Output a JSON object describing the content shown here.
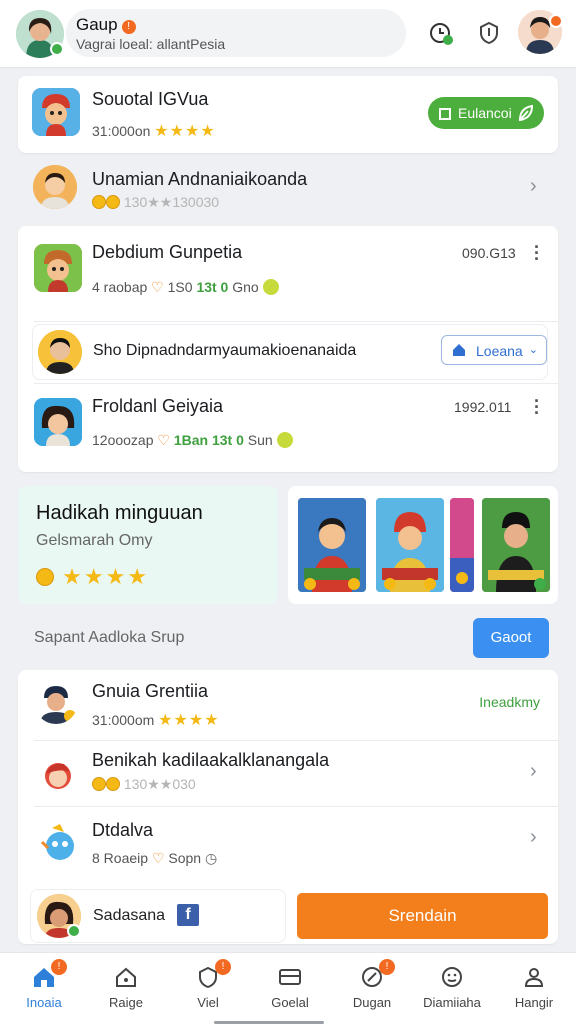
{
  "header": {
    "title": "Gaup",
    "title_badge": "!",
    "subtitle": "Vagrai loeal: allantPesia"
  },
  "list1": {
    "item1": {
      "title": "Souotal IGVua",
      "meta": "31:000on",
      "stars": "★★★★",
      "button": "Eulancoi"
    },
    "item2": {
      "title": "Unamian Andnaniaikoanda",
      "meta": "130★★130030"
    }
  },
  "list2": {
    "item1": {
      "title": "Debdium Gunpetia",
      "date": "090.G13",
      "meta_a": "4 raobap",
      "meta_b": "1S0",
      "meta_c": "13t 0",
      "meta_d": "Gno"
    },
    "item2": {
      "title": "Sho Dipnadndarmyaumakioenanaida",
      "button": "Loeana"
    },
    "item3": {
      "title": "Froldanl Geiyaia",
      "date": "1992.011",
      "meta_a": "12ooozap",
      "meta_b": "1Ban",
      "meta_c": "13t 0",
      "meta_d": "Sun"
    }
  },
  "promo": {
    "title": "Hadikah minguuan",
    "subtitle": "Gelsmarah Omy",
    "stars": "★★★★"
  },
  "section": {
    "label": "Sapant Aadloka Srup",
    "button": "Gaoot"
  },
  "list3": {
    "item1": {
      "title": "Gnuia Grentiia",
      "meta": "31:000om",
      "stars": "★★★★",
      "status": "Ineadkmy"
    },
    "item2": {
      "title": "Benikah kadilaakalklanangala",
      "meta": "130★★030"
    },
    "item3": {
      "title": "Dtdalva",
      "meta_a": "8 Roaeip",
      "meta_b": "Sopn"
    }
  },
  "share": {
    "label": "Sadasana",
    "fb": "f"
  },
  "primary_button": "Srendain",
  "nav": [
    {
      "label": "Inoaia",
      "badge": "!"
    },
    {
      "label": "Raige",
      "badge": ""
    },
    {
      "label": "Viel",
      "badge": "!"
    },
    {
      "label": "Goelal",
      "badge": ""
    },
    {
      "label": "Dugan",
      "badge": "!"
    },
    {
      "label": "Diamiiaha",
      "badge": ""
    },
    {
      "label": "Hangir",
      "badge": ""
    }
  ],
  "colors": {
    "accent_green": "#4cae3c",
    "accent_blue": "#3b8ff0",
    "accent_orange": "#f27f1b",
    "badge_orange": "#f26a21",
    "promo_bg": "#e9f8f3"
  }
}
